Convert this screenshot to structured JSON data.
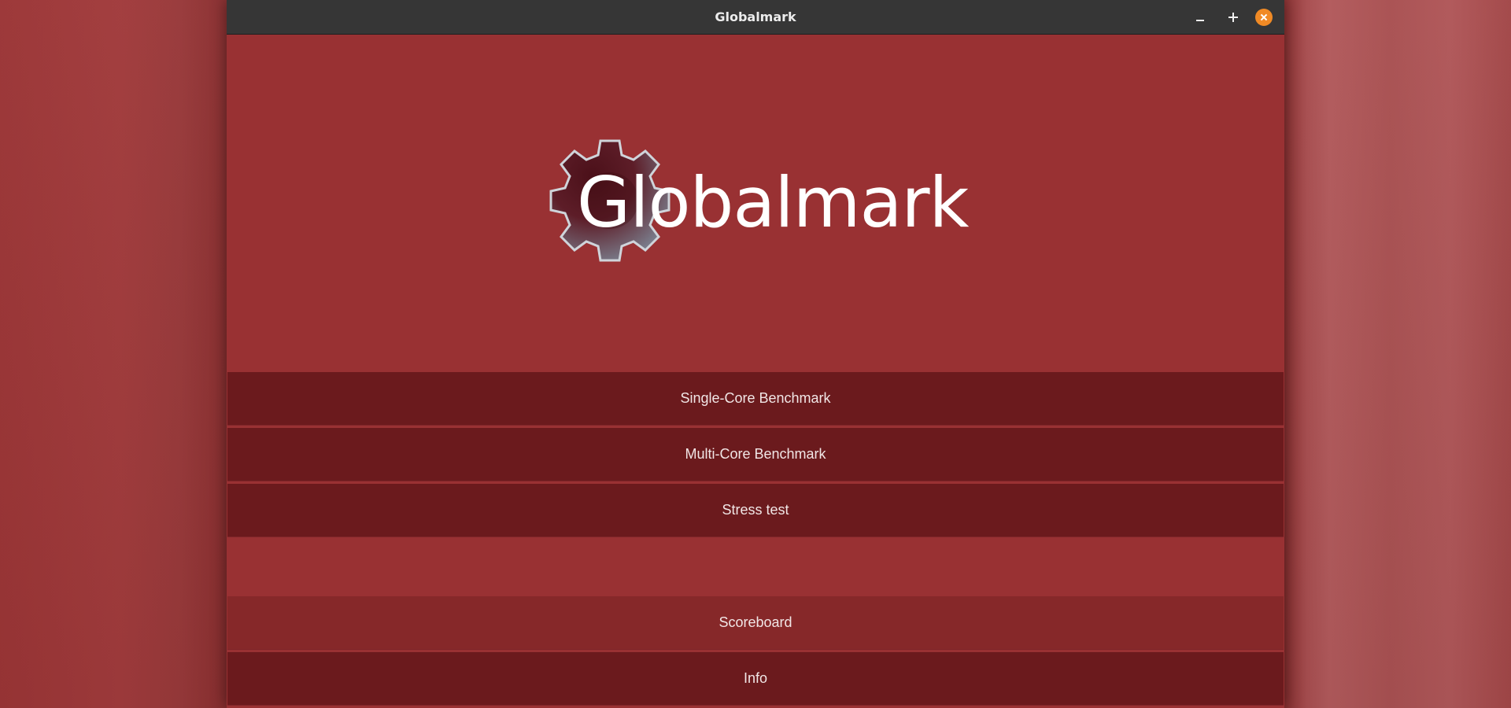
{
  "window": {
    "title": "Globalmark"
  },
  "titlebar": {
    "minimize_icon": "minimize-icon",
    "maximize_icon": "maximize-icon",
    "close_icon": "close-icon"
  },
  "logo": {
    "wordmark": "Globalmark",
    "icon": "gear-icon"
  },
  "menu": {
    "single_core": "Single-Core Benchmark",
    "multi_core": "Multi-Core Benchmark",
    "stress_test": "Stress test",
    "scoreboard": "Scoreboard",
    "info": "Info"
  },
  "colors": {
    "window_bg": "#993133",
    "button_bg": "#6b1a1d",
    "button_highlight_bg": "#862829",
    "titlebar_bg": "#363636",
    "close_button": "#f08a25"
  }
}
